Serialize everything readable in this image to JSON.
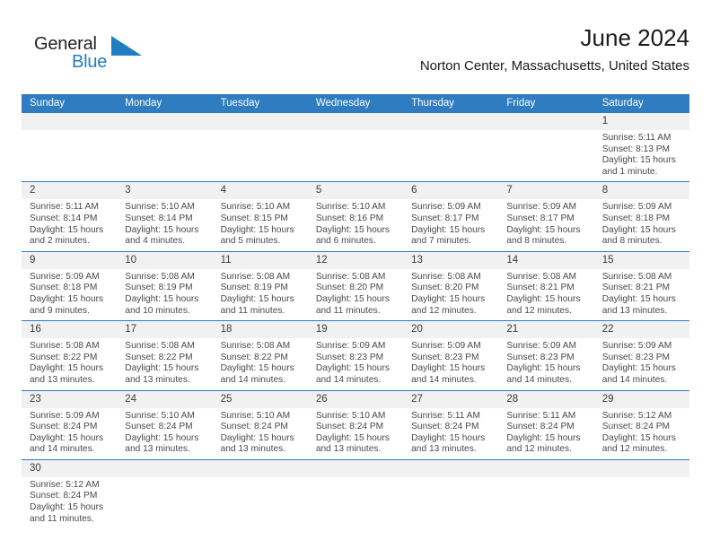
{
  "brand": {
    "name_part1": "General",
    "name_part2": "Blue",
    "logo_icon": "triangle-logo-icon",
    "accent_color": "#1f7dc1"
  },
  "header": {
    "month_title": "June 2024",
    "location": "Norton Center, Massachusetts, United States"
  },
  "calendar": {
    "header_color": "#2f7cc0",
    "day_band_color": "#f1f1f1",
    "weekdays": [
      "Sunday",
      "Monday",
      "Tuesday",
      "Wednesday",
      "Thursday",
      "Friday",
      "Saturday"
    ],
    "weeks": [
      [
        {
          "date": "",
          "blank": true
        },
        {
          "date": "",
          "blank": true
        },
        {
          "date": "",
          "blank": true
        },
        {
          "date": "",
          "blank": true
        },
        {
          "date": "",
          "blank": true
        },
        {
          "date": "",
          "blank": true
        },
        {
          "date": "1",
          "sunrise": "Sunrise: 5:11 AM",
          "sunset": "Sunset: 8:13 PM",
          "daylight": "Daylight: 15 hours and 1 minute."
        }
      ],
      [
        {
          "date": "2",
          "sunrise": "Sunrise: 5:11 AM",
          "sunset": "Sunset: 8:14 PM",
          "daylight": "Daylight: 15 hours and 2 minutes."
        },
        {
          "date": "3",
          "sunrise": "Sunrise: 5:10 AM",
          "sunset": "Sunset: 8:14 PM",
          "daylight": "Daylight: 15 hours and 4 minutes."
        },
        {
          "date": "4",
          "sunrise": "Sunrise: 5:10 AM",
          "sunset": "Sunset: 8:15 PM",
          "daylight": "Daylight: 15 hours and 5 minutes."
        },
        {
          "date": "5",
          "sunrise": "Sunrise: 5:10 AM",
          "sunset": "Sunset: 8:16 PM",
          "daylight": "Daylight: 15 hours and 6 minutes."
        },
        {
          "date": "6",
          "sunrise": "Sunrise: 5:09 AM",
          "sunset": "Sunset: 8:17 PM",
          "daylight": "Daylight: 15 hours and 7 minutes."
        },
        {
          "date": "7",
          "sunrise": "Sunrise: 5:09 AM",
          "sunset": "Sunset: 8:17 PM",
          "daylight": "Daylight: 15 hours and 8 minutes."
        },
        {
          "date": "8",
          "sunrise": "Sunrise: 5:09 AM",
          "sunset": "Sunset: 8:18 PM",
          "daylight": "Daylight: 15 hours and 8 minutes."
        }
      ],
      [
        {
          "date": "9",
          "sunrise": "Sunrise: 5:09 AM",
          "sunset": "Sunset: 8:18 PM",
          "daylight": "Daylight: 15 hours and 9 minutes."
        },
        {
          "date": "10",
          "sunrise": "Sunrise: 5:08 AM",
          "sunset": "Sunset: 8:19 PM",
          "daylight": "Daylight: 15 hours and 10 minutes."
        },
        {
          "date": "11",
          "sunrise": "Sunrise: 5:08 AM",
          "sunset": "Sunset: 8:19 PM",
          "daylight": "Daylight: 15 hours and 11 minutes."
        },
        {
          "date": "12",
          "sunrise": "Sunrise: 5:08 AM",
          "sunset": "Sunset: 8:20 PM",
          "daylight": "Daylight: 15 hours and 11 minutes."
        },
        {
          "date": "13",
          "sunrise": "Sunrise: 5:08 AM",
          "sunset": "Sunset: 8:20 PM",
          "daylight": "Daylight: 15 hours and 12 minutes."
        },
        {
          "date": "14",
          "sunrise": "Sunrise: 5:08 AM",
          "sunset": "Sunset: 8:21 PM",
          "daylight": "Daylight: 15 hours and 12 minutes."
        },
        {
          "date": "15",
          "sunrise": "Sunrise: 5:08 AM",
          "sunset": "Sunset: 8:21 PM",
          "daylight": "Daylight: 15 hours and 13 minutes."
        }
      ],
      [
        {
          "date": "16",
          "sunrise": "Sunrise: 5:08 AM",
          "sunset": "Sunset: 8:22 PM",
          "daylight": "Daylight: 15 hours and 13 minutes."
        },
        {
          "date": "17",
          "sunrise": "Sunrise: 5:08 AM",
          "sunset": "Sunset: 8:22 PM",
          "daylight": "Daylight: 15 hours and 13 minutes."
        },
        {
          "date": "18",
          "sunrise": "Sunrise: 5:08 AM",
          "sunset": "Sunset: 8:22 PM",
          "daylight": "Daylight: 15 hours and 14 minutes."
        },
        {
          "date": "19",
          "sunrise": "Sunrise: 5:09 AM",
          "sunset": "Sunset: 8:23 PM",
          "daylight": "Daylight: 15 hours and 14 minutes."
        },
        {
          "date": "20",
          "sunrise": "Sunrise: 5:09 AM",
          "sunset": "Sunset: 8:23 PM",
          "daylight": "Daylight: 15 hours and 14 minutes."
        },
        {
          "date": "21",
          "sunrise": "Sunrise: 5:09 AM",
          "sunset": "Sunset: 8:23 PM",
          "daylight": "Daylight: 15 hours and 14 minutes."
        },
        {
          "date": "22",
          "sunrise": "Sunrise: 5:09 AM",
          "sunset": "Sunset: 8:23 PM",
          "daylight": "Daylight: 15 hours and 14 minutes."
        }
      ],
      [
        {
          "date": "23",
          "sunrise": "Sunrise: 5:09 AM",
          "sunset": "Sunset: 8:24 PM",
          "daylight": "Daylight: 15 hours and 14 minutes."
        },
        {
          "date": "24",
          "sunrise": "Sunrise: 5:10 AM",
          "sunset": "Sunset: 8:24 PM",
          "daylight": "Daylight: 15 hours and 13 minutes."
        },
        {
          "date": "25",
          "sunrise": "Sunrise: 5:10 AM",
          "sunset": "Sunset: 8:24 PM",
          "daylight": "Daylight: 15 hours and 13 minutes."
        },
        {
          "date": "26",
          "sunrise": "Sunrise: 5:10 AM",
          "sunset": "Sunset: 8:24 PM",
          "daylight": "Daylight: 15 hours and 13 minutes."
        },
        {
          "date": "27",
          "sunrise": "Sunrise: 5:11 AM",
          "sunset": "Sunset: 8:24 PM",
          "daylight": "Daylight: 15 hours and 13 minutes."
        },
        {
          "date": "28",
          "sunrise": "Sunrise: 5:11 AM",
          "sunset": "Sunset: 8:24 PM",
          "daylight": "Daylight: 15 hours and 12 minutes."
        },
        {
          "date": "29",
          "sunrise": "Sunrise: 5:12 AM",
          "sunset": "Sunset: 8:24 PM",
          "daylight": "Daylight: 15 hours and 12 minutes."
        }
      ],
      [
        {
          "date": "30",
          "sunrise": "Sunrise: 5:12 AM",
          "sunset": "Sunset: 8:24 PM",
          "daylight": "Daylight: 15 hours and 11 minutes."
        },
        {
          "date": "",
          "blank": true
        },
        {
          "date": "",
          "blank": true
        },
        {
          "date": "",
          "blank": true
        },
        {
          "date": "",
          "blank": true
        },
        {
          "date": "",
          "blank": true
        },
        {
          "date": "",
          "blank": true
        }
      ]
    ]
  }
}
